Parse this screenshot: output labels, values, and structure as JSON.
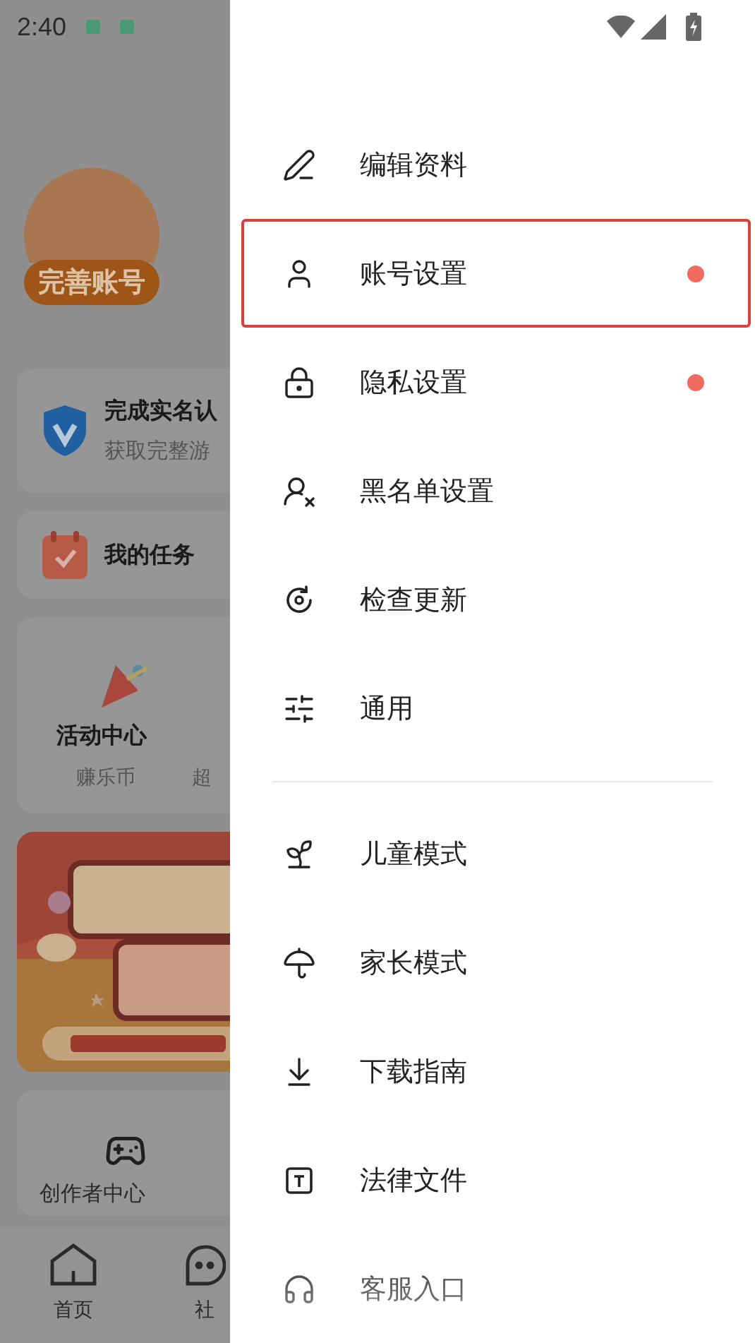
{
  "status_bar": {
    "time": "2:40"
  },
  "background_page": {
    "profile": {
      "badge": "完善账号"
    },
    "verify_card": {
      "title": "完成实名认",
      "subtitle": "获取完整游"
    },
    "tasks_card": {
      "title": "我的任务"
    },
    "activity_card": {
      "title": "活动中心",
      "caption": "赚乐币",
      "caption_2": "超"
    },
    "creator_card": {
      "title": "创作者中心"
    },
    "bottom_nav": [
      {
        "label": "首页",
        "kind": "home"
      },
      {
        "label": "社",
        "kind": "community"
      }
    ]
  },
  "drawer": {
    "groups": [
      [
        {
          "label": "编辑资料",
          "kind": "pen",
          "dot": false,
          "highlighted": false
        },
        {
          "label": "账号设置",
          "kind": "user",
          "dot": true,
          "highlighted": true
        },
        {
          "label": "隐私设置",
          "kind": "lock",
          "dot": true,
          "highlighted": false
        },
        {
          "label": "黑名单设置",
          "kind": "block-user",
          "dot": false,
          "highlighted": false
        },
        {
          "label": "检查更新",
          "kind": "update",
          "dot": false,
          "highlighted": false
        },
        {
          "label": "通用",
          "kind": "sliders",
          "dot": false,
          "highlighted": false
        }
      ],
      [
        {
          "label": "儿童模式",
          "kind": "sprout",
          "dot": false,
          "highlighted": false
        },
        {
          "label": "家长模式",
          "kind": "umbrella",
          "dot": false,
          "highlighted": false
        },
        {
          "label": "下载指南",
          "kind": "download",
          "dot": false,
          "highlighted": false
        },
        {
          "label": "法律文件",
          "kind": "document",
          "dot": false,
          "highlighted": false
        },
        {
          "label": "客服入口",
          "kind": "headphones",
          "dot": false,
          "highlighted": false
        }
      ]
    ]
  }
}
